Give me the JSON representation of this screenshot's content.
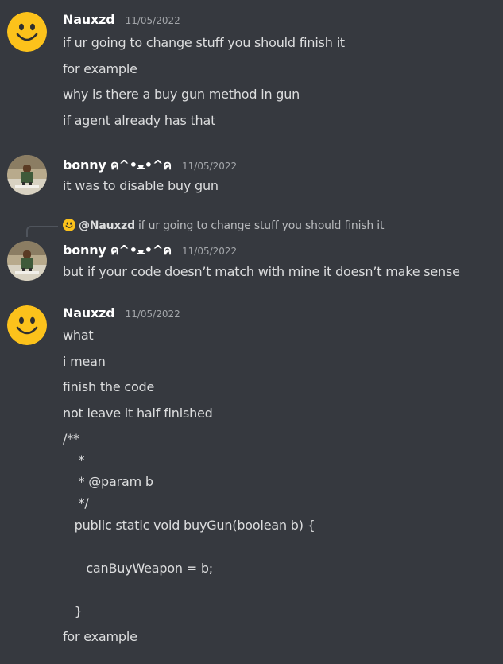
{
  "messages": [
    {
      "username": "Nauxzd",
      "timestamp": "11/05/2022",
      "avatar": "smiley-face-icon",
      "lines": [
        "if ur going to change stuff you should finish it",
        "for example",
        "why is there a buy gun method in gun",
        "if agent already has that"
      ]
    },
    {
      "username": "bonny ค^•ﻌ•^ค",
      "timestamp": "11/05/2022",
      "avatar": "user-photo-avatar",
      "lines": [
        "it was to disable buy gun"
      ]
    },
    {
      "reply_to": {
        "mention": "@Nauxzd",
        "text": "if ur going to change stuff you should finish it"
      },
      "username": "bonny ค^•ﻌ•^ค",
      "timestamp": "11/05/2022",
      "avatar": "user-photo-avatar",
      "lines": [
        "but if your code doesn’t match with mine it doesn’t make sense"
      ]
    },
    {
      "username": "Nauxzd",
      "timestamp": "11/05/2022",
      "avatar": "smiley-face-icon",
      "lines": [
        "what",
        "i mean",
        "finish the code",
        "not leave it half finished",
        "/**",
        "    *",
        "    * @param b",
        "    */",
        "   public static void buyGun(boolean b) {",
        "",
        "      canBuyWeapon = b;",
        "",
        "   }",
        "for example"
      ]
    }
  ],
  "colors": {
    "background": "#36393f",
    "username": "#ffffff",
    "text": "#dcddde",
    "timestamp": "#a3a6aa",
    "smiley": "#fcc21b"
  }
}
